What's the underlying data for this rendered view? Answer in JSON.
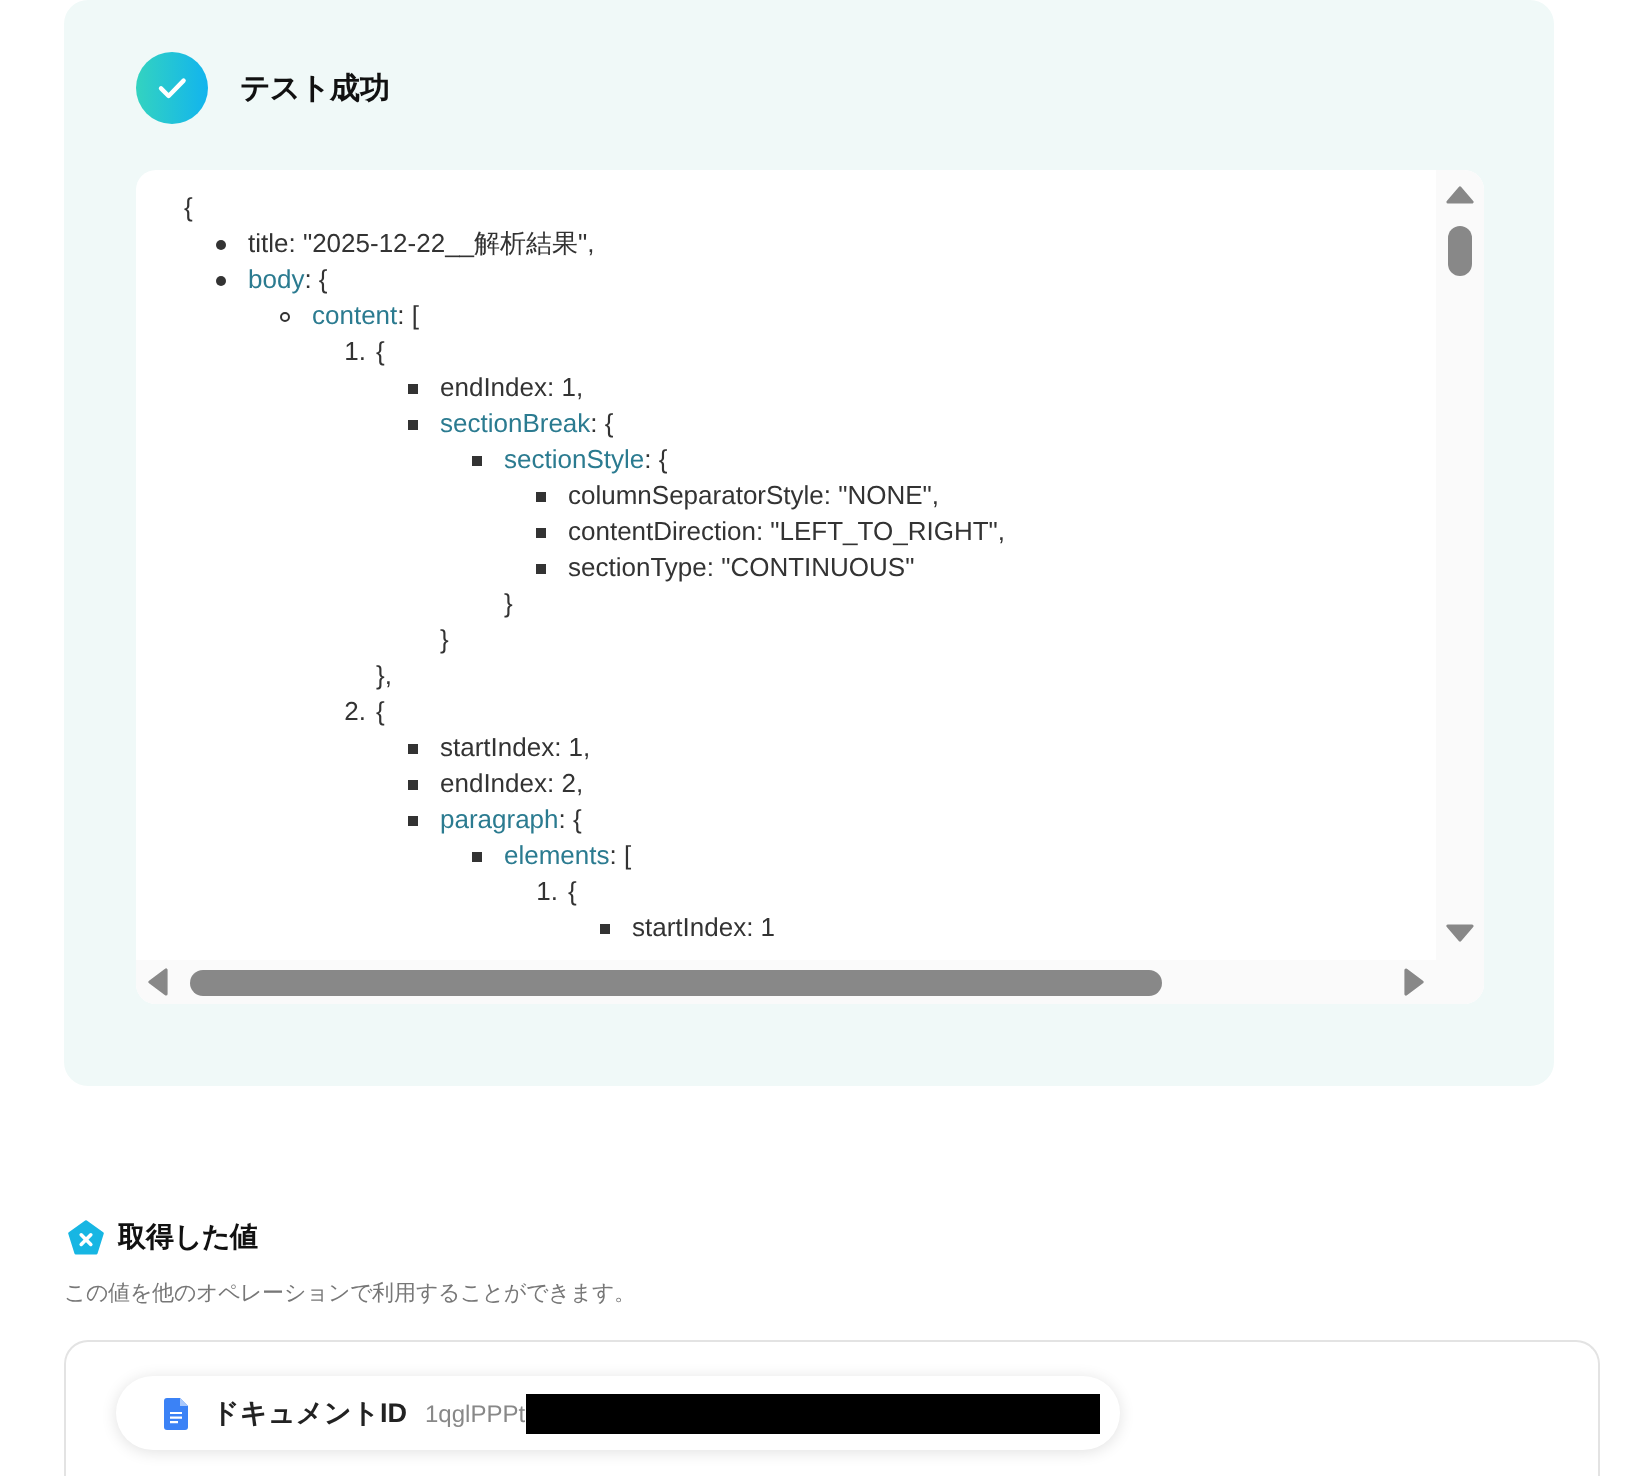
{
  "test_result": {
    "title": "テスト成功",
    "json_view": {
      "open": "{",
      "children": [
        {
          "text": "title: \"2025-12-22__解析結果\","
        },
        {
          "key": "body",
          "text": ": {",
          "children": [
            {
              "key": "content",
              "text": ": [",
              "children": [
                {
                  "number": "1.",
                  "text": "{",
                  "children": [
                    {
                      "text": "endIndex: 1,"
                    },
                    {
                      "key": "sectionBreak",
                      "text": ": {",
                      "children": [
                        {
                          "key": "sectionStyle",
                          "text": ": {",
                          "children": [
                            {
                              "text": "columnSeparatorStyle: \"NONE\","
                            },
                            {
                              "text": "contentDirection: \"LEFT_TO_RIGHT\","
                            },
                            {
                              "text": "sectionType: \"CONTINUOUS\""
                            }
                          ],
                          "close": "}"
                        }
                      ],
                      "close": "}"
                    }
                  ],
                  "close": "},"
                },
                {
                  "number": "2.",
                  "text": "{",
                  "children": [
                    {
                      "text": "startIndex: 1,"
                    },
                    {
                      "text": "endIndex: 2,"
                    },
                    {
                      "key": "paragraph",
                      "text": ": {",
                      "children": [
                        {
                          "key": "elements",
                          "text": ": [",
                          "children": [
                            {
                              "number": "1.",
                              "text": "{",
                              "children": [
                                {
                                  "text": "startIndex: 1"
                                }
                              ]
                            }
                          ]
                        }
                      ]
                    }
                  ]
                }
              ]
            }
          ]
        }
      ]
    }
  },
  "output_values": {
    "title": "取得した値",
    "description": "この値を他のオペレーションで利用することができます。",
    "fields": [
      {
        "label": "ドキュメントID",
        "value": "1qglPPPt",
        "redacted": true
      }
    ]
  }
}
